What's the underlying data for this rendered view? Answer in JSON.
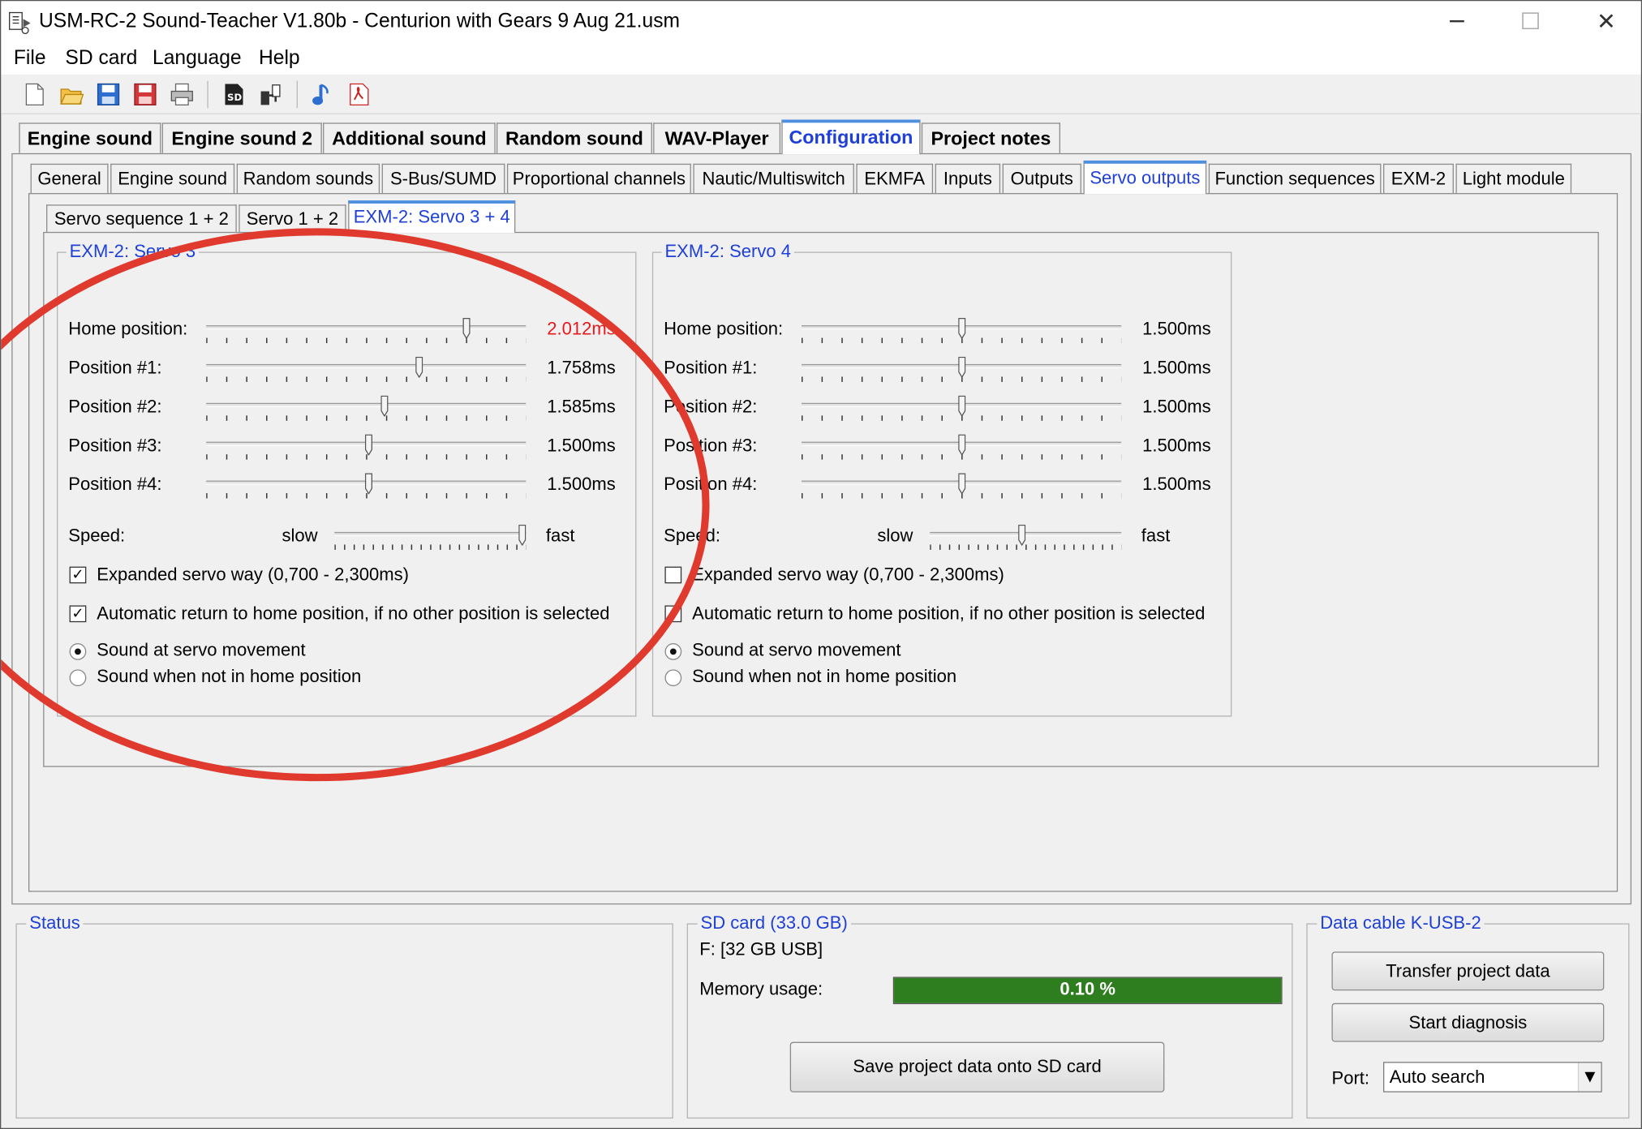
{
  "window": {
    "title": "USM-RC-2 Sound-Teacher V1.80b - Centurion with Gears 9 Aug 21.usm",
    "controls": {
      "minimize": "─",
      "maximize": "☐",
      "close": "✕"
    }
  },
  "menu": [
    "File",
    "SD card",
    "Language",
    "Help"
  ],
  "toolbar": {
    "icons": [
      "new-file-icon",
      "open-folder-icon",
      "save-icon",
      "save-as-icon",
      "print-icon",
      "sd-card-icon",
      "transfer-icon",
      "music-note-icon",
      "pdf-icon"
    ]
  },
  "main_tabs": [
    "Engine sound",
    "Engine sound 2",
    "Additional sound",
    "Random sound",
    "WAV-Player",
    "Configuration",
    "Project notes"
  ],
  "main_tabs_active": "Configuration",
  "config_tabs": [
    "General",
    "Engine sound",
    "Random sounds",
    "S-Bus/SUMD",
    "Proportional channels",
    "Nautic/Multiswitch",
    "EKMFA",
    "Inputs",
    "Outputs",
    "Servo outputs",
    "Function sequences",
    "EXM-2",
    "Light module"
  ],
  "config_tabs_active": "Servo outputs",
  "servo_tabs": [
    "Servo sequence  1 + 2",
    "Servo 1 + 2",
    "EXM-2: Servo 3 + 4"
  ],
  "servo_tabs_active": "EXM-2: Servo 3 + 4",
  "servo_groups": [
    {
      "title": "EXM-2: Servo 3",
      "sliders": [
        {
          "label": "Home position:",
          "value": "2.012ms",
          "highlight": true,
          "fraction": 0.82
        },
        {
          "label": "Position #1:",
          "value": "1.758ms",
          "highlight": false,
          "fraction": 0.67
        },
        {
          "label": "Position #2:",
          "value": "1.585ms",
          "highlight": false,
          "fraction": 0.56
        },
        {
          "label": "Position #3:",
          "value": "1.500ms",
          "highlight": false,
          "fraction": 0.51
        },
        {
          "label": "Position #4:",
          "value": "1.500ms",
          "highlight": false,
          "fraction": 0.51
        }
      ],
      "speed": {
        "label": "Speed:",
        "slow": "slow",
        "fast": "fast",
        "fraction": 1.0
      },
      "checkboxes": [
        {
          "label": "Expanded servo way (0,700 - 2,300ms)",
          "checked": true
        },
        {
          "label": "Automatic return to home position, if no other position is selected",
          "checked": true
        }
      ],
      "radios": [
        {
          "label": "Sound at servo movement",
          "selected": true
        },
        {
          "label": "Sound when not in home position",
          "selected": false
        }
      ]
    },
    {
      "title": "EXM-2: Servo 4",
      "sliders": [
        {
          "label": "Home position:",
          "value": "1.500ms",
          "highlight": false,
          "fraction": 0.5
        },
        {
          "label": "Position #1:",
          "value": "1.500ms",
          "highlight": false,
          "fraction": 0.5
        },
        {
          "label": "Position #2:",
          "value": "1.500ms",
          "highlight": false,
          "fraction": 0.5
        },
        {
          "label": "Position #3:",
          "value": "1.500ms",
          "highlight": false,
          "fraction": 0.5
        },
        {
          "label": "Position #4:",
          "value": "1.500ms",
          "highlight": false,
          "fraction": 0.5
        }
      ],
      "speed": {
        "label": "Speed:",
        "slow": "slow",
        "fast": "fast",
        "fraction": 0.48
      },
      "checkboxes": [
        {
          "label": "Expanded servo way (0,700 - 2,300ms)",
          "checked": false
        },
        {
          "label": "Automatic return to home position, if no other position is selected",
          "checked": false
        }
      ],
      "radios": [
        {
          "label": "Sound at servo movement",
          "selected": true
        },
        {
          "label": "Sound when not in home position",
          "selected": false
        }
      ]
    }
  ],
  "status": {
    "title": "Status"
  },
  "sd_card": {
    "title": "SD card (33.0 GB)",
    "drive": "F: [32 GB USB]",
    "memory_label": "Memory usage:",
    "memory_text": "0.10 %",
    "memory_fraction": 1.0,
    "save_button": "Save project data onto SD card"
  },
  "data_cable": {
    "title": "Data cable K-USB-2",
    "transfer_button": "Transfer project data",
    "diagnosis_button": "Start diagnosis",
    "port_label": "Port:",
    "port_value": "Auto search"
  },
  "colors": {
    "accent": "#1e3fd8",
    "highlight_value": "#e8191c",
    "progress": "#2e7d1f",
    "annotation": "#e03a2f"
  }
}
